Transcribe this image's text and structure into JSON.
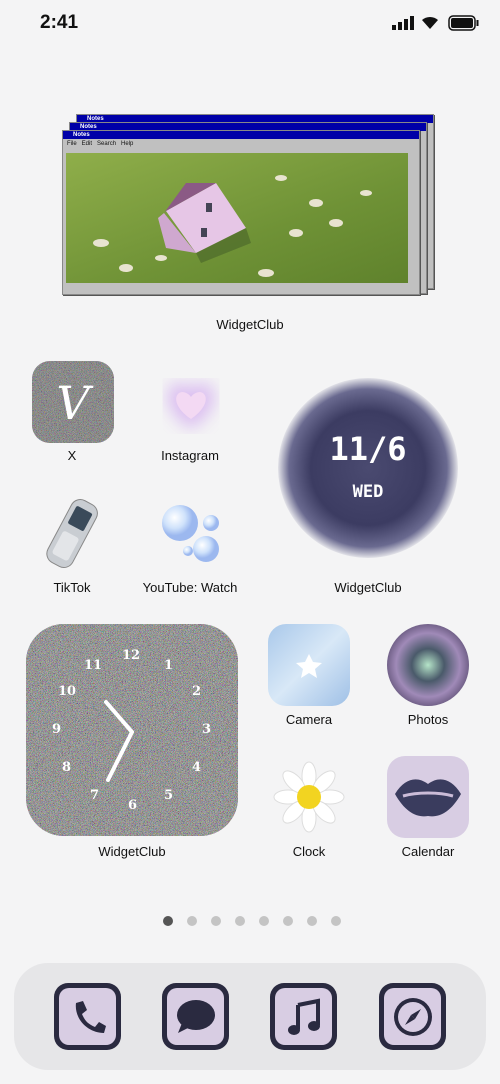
{
  "status": {
    "time": "2:41",
    "icons": [
      "signal-icon",
      "wifi-icon",
      "battery-icon"
    ]
  },
  "notes_widget": {
    "window_title": "Notes",
    "menu": [
      "File",
      "Edit",
      "Search",
      "Help"
    ],
    "label": "WidgetClub"
  },
  "apps": [
    {
      "label": "X",
      "icon": "x-script-icon"
    },
    {
      "label": "Instagram",
      "icon": "heart-icon"
    },
    {
      "label": "TikTok",
      "icon": "flip-phone-icon"
    },
    {
      "label": "YouTube: Watch",
      "icon": "bubbles-icon"
    },
    {
      "label": "Camera",
      "icon": "star-sky-icon"
    },
    {
      "label": "Photos",
      "icon": "ring-icon"
    },
    {
      "label": "Clock",
      "icon": "daisy-icon"
    },
    {
      "label": "Calendar",
      "icon": "lips-icon"
    }
  ],
  "date_widget": {
    "date": "11/6",
    "weekday": "WED",
    "label": "WidgetClub"
  },
  "clock_widget": {
    "label": "WidgetClub",
    "numbers": [
      "12",
      "1",
      "2",
      "3",
      "4",
      "5",
      "6",
      "7",
      "8",
      "9",
      "10",
      "11"
    ]
  },
  "page_dots": {
    "count": 8,
    "active": 0
  },
  "dock": [
    {
      "name": "phone",
      "icon": "phone-icon"
    },
    {
      "name": "messages",
      "icon": "message-bubble-icon"
    },
    {
      "name": "music",
      "icon": "music-note-icon"
    },
    {
      "name": "safari",
      "icon": "compass-icon"
    }
  ]
}
